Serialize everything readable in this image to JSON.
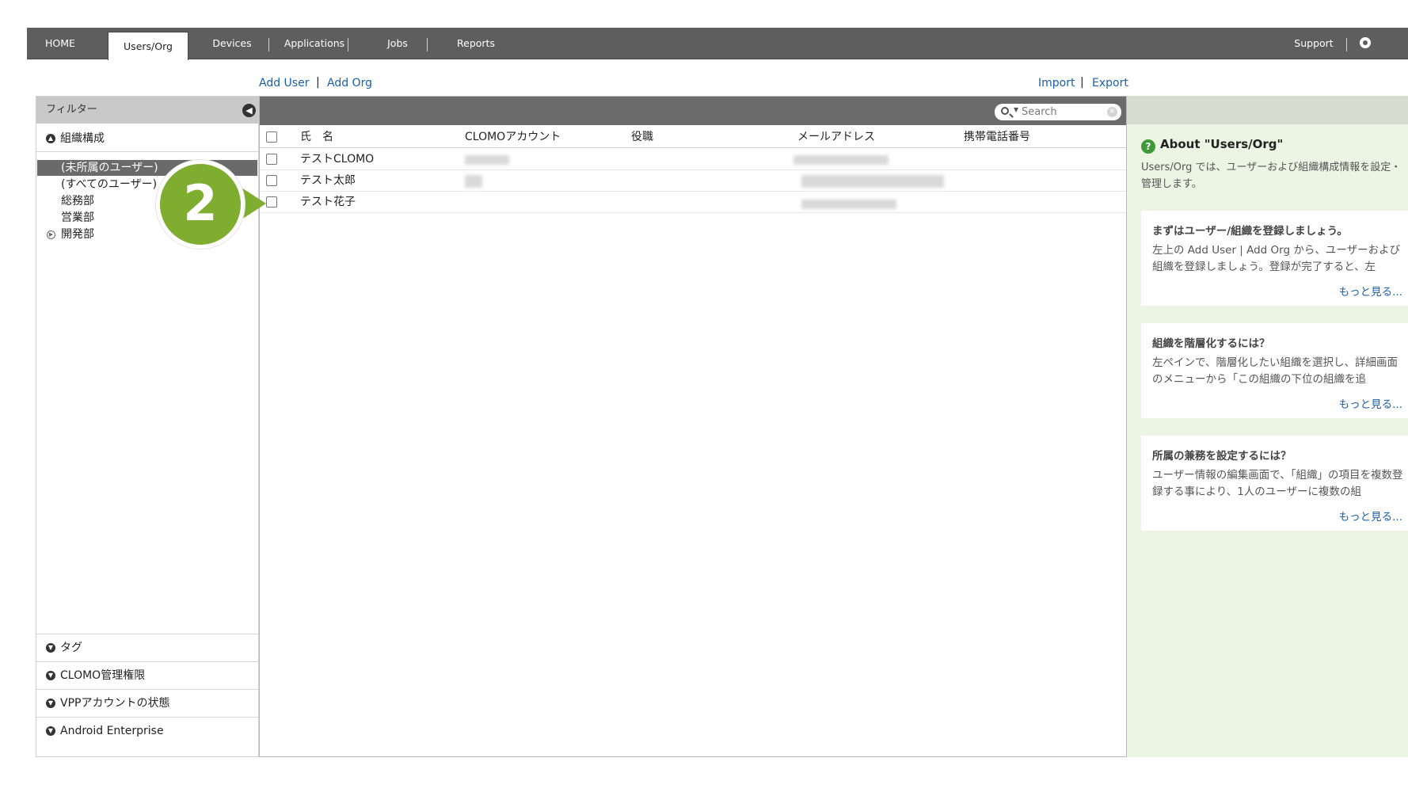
{
  "nav": {
    "tabs": [
      "HOME",
      "Users/Org",
      "Devices",
      "Applications",
      "Jobs",
      "Reports"
    ],
    "active_tab": "Users/Org",
    "support": "Support",
    "settings": "Setting"
  },
  "actions": {
    "add_user": "Add User",
    "add_org": "Add Org",
    "import": "Import",
    "export": "Export",
    "separator": "|"
  },
  "sidebar": {
    "filter_title": "フィルター",
    "org_section": "組織構成",
    "tree": [
      {
        "label": "(未所属のユーザー)",
        "selected": true
      },
      {
        "label": "(すべてのユーザー)"
      },
      {
        "label": "総務部"
      },
      {
        "label": "営業部"
      },
      {
        "label": "開発部",
        "expandable": true
      }
    ],
    "sections": [
      "タグ",
      "CLOMO管理権限",
      "VPPアカウントの状態",
      "Android Enterprise"
    ]
  },
  "callout": {
    "step": "2"
  },
  "table": {
    "search_placeholder": "Search",
    "columns": [
      "氏　名",
      "CLOMOアカウント",
      "役職",
      "メールアドレス",
      "携帯電話番号"
    ],
    "rows": [
      {
        "name": "テストCLOMO"
      },
      {
        "name": "テスト太郎"
      },
      {
        "name": "テスト花子"
      }
    ]
  },
  "help": {
    "title": "About \"Users/Org\"",
    "description": "Users/Org では、ユーザーおよび組織構成情報を設定・管理します。",
    "cards": [
      {
        "title": "まずはユーザー/組織を登録しましょう。",
        "body": "左上の Add User | Add Org から、ユーザーおよび組織を登録しましょう。登録が完了すると、左",
        "more": "もっと見る..."
      },
      {
        "title": "組織を階層化するには？",
        "body": "左ペインで、階層化したい組織を選択し、詳細画面のメニューから「この組織の下位の組織を追",
        "more": "もっと見る..."
      },
      {
        "title": "所属の兼務を設定するには？",
        "body": "ユーザー情報の編集画面で、「組織」の項目を複数登録する事により、1人のユーザーに複数の組",
        "more": "もっと見る..."
      }
    ]
  },
  "colors": {
    "nav_bg": "#5e5e5e",
    "link": "#1a5fa8",
    "badge": "#7fad2f",
    "help_bg": "#ecf5e3"
  }
}
